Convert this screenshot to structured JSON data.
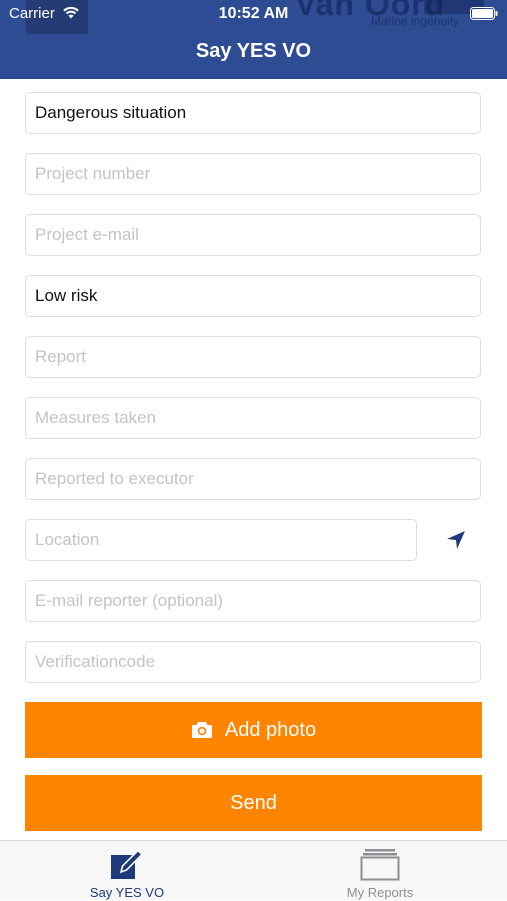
{
  "status_bar": {
    "carrier": "Carrier",
    "time": "10:52 AM"
  },
  "header": {
    "title": "Say YES VO",
    "background_logo": "Van Oord",
    "background_logo_sub": "Marine ingenuity",
    "color": "#2d4c93"
  },
  "form": {
    "incident_type": {
      "value": "Dangerous situation",
      "placeholder": ""
    },
    "project_number": {
      "value": "",
      "placeholder": "Project number"
    },
    "project_email": {
      "value": "",
      "placeholder": "Project e-mail"
    },
    "risk_level": {
      "value": "Low risk",
      "placeholder": ""
    },
    "report": {
      "value": "",
      "placeholder": "Report"
    },
    "measures_taken": {
      "value": "",
      "placeholder": "Measures taken"
    },
    "reported_to_executor": {
      "value": "",
      "placeholder": "Reported to executor"
    },
    "location": {
      "value": "",
      "placeholder": "Location",
      "icon": "location-arrow-icon"
    },
    "email_reporter": {
      "value": "",
      "placeholder": "E-mail reporter (optional)"
    },
    "verification_code": {
      "value": "",
      "placeholder": "Verificationcode"
    }
  },
  "buttons": {
    "add_photo": {
      "label": "Add photo",
      "icon": "camera-icon"
    },
    "send": {
      "label": "Send"
    },
    "accent_color": "#ff8400"
  },
  "tabbar": {
    "items": [
      {
        "label": "Say YES VO",
        "icon": "edit-icon",
        "active": true
      },
      {
        "label": "My Reports",
        "icon": "reports-icon",
        "active": false
      }
    ],
    "active_color": "#1f3a7a",
    "inactive_color": "#8e8e93"
  }
}
